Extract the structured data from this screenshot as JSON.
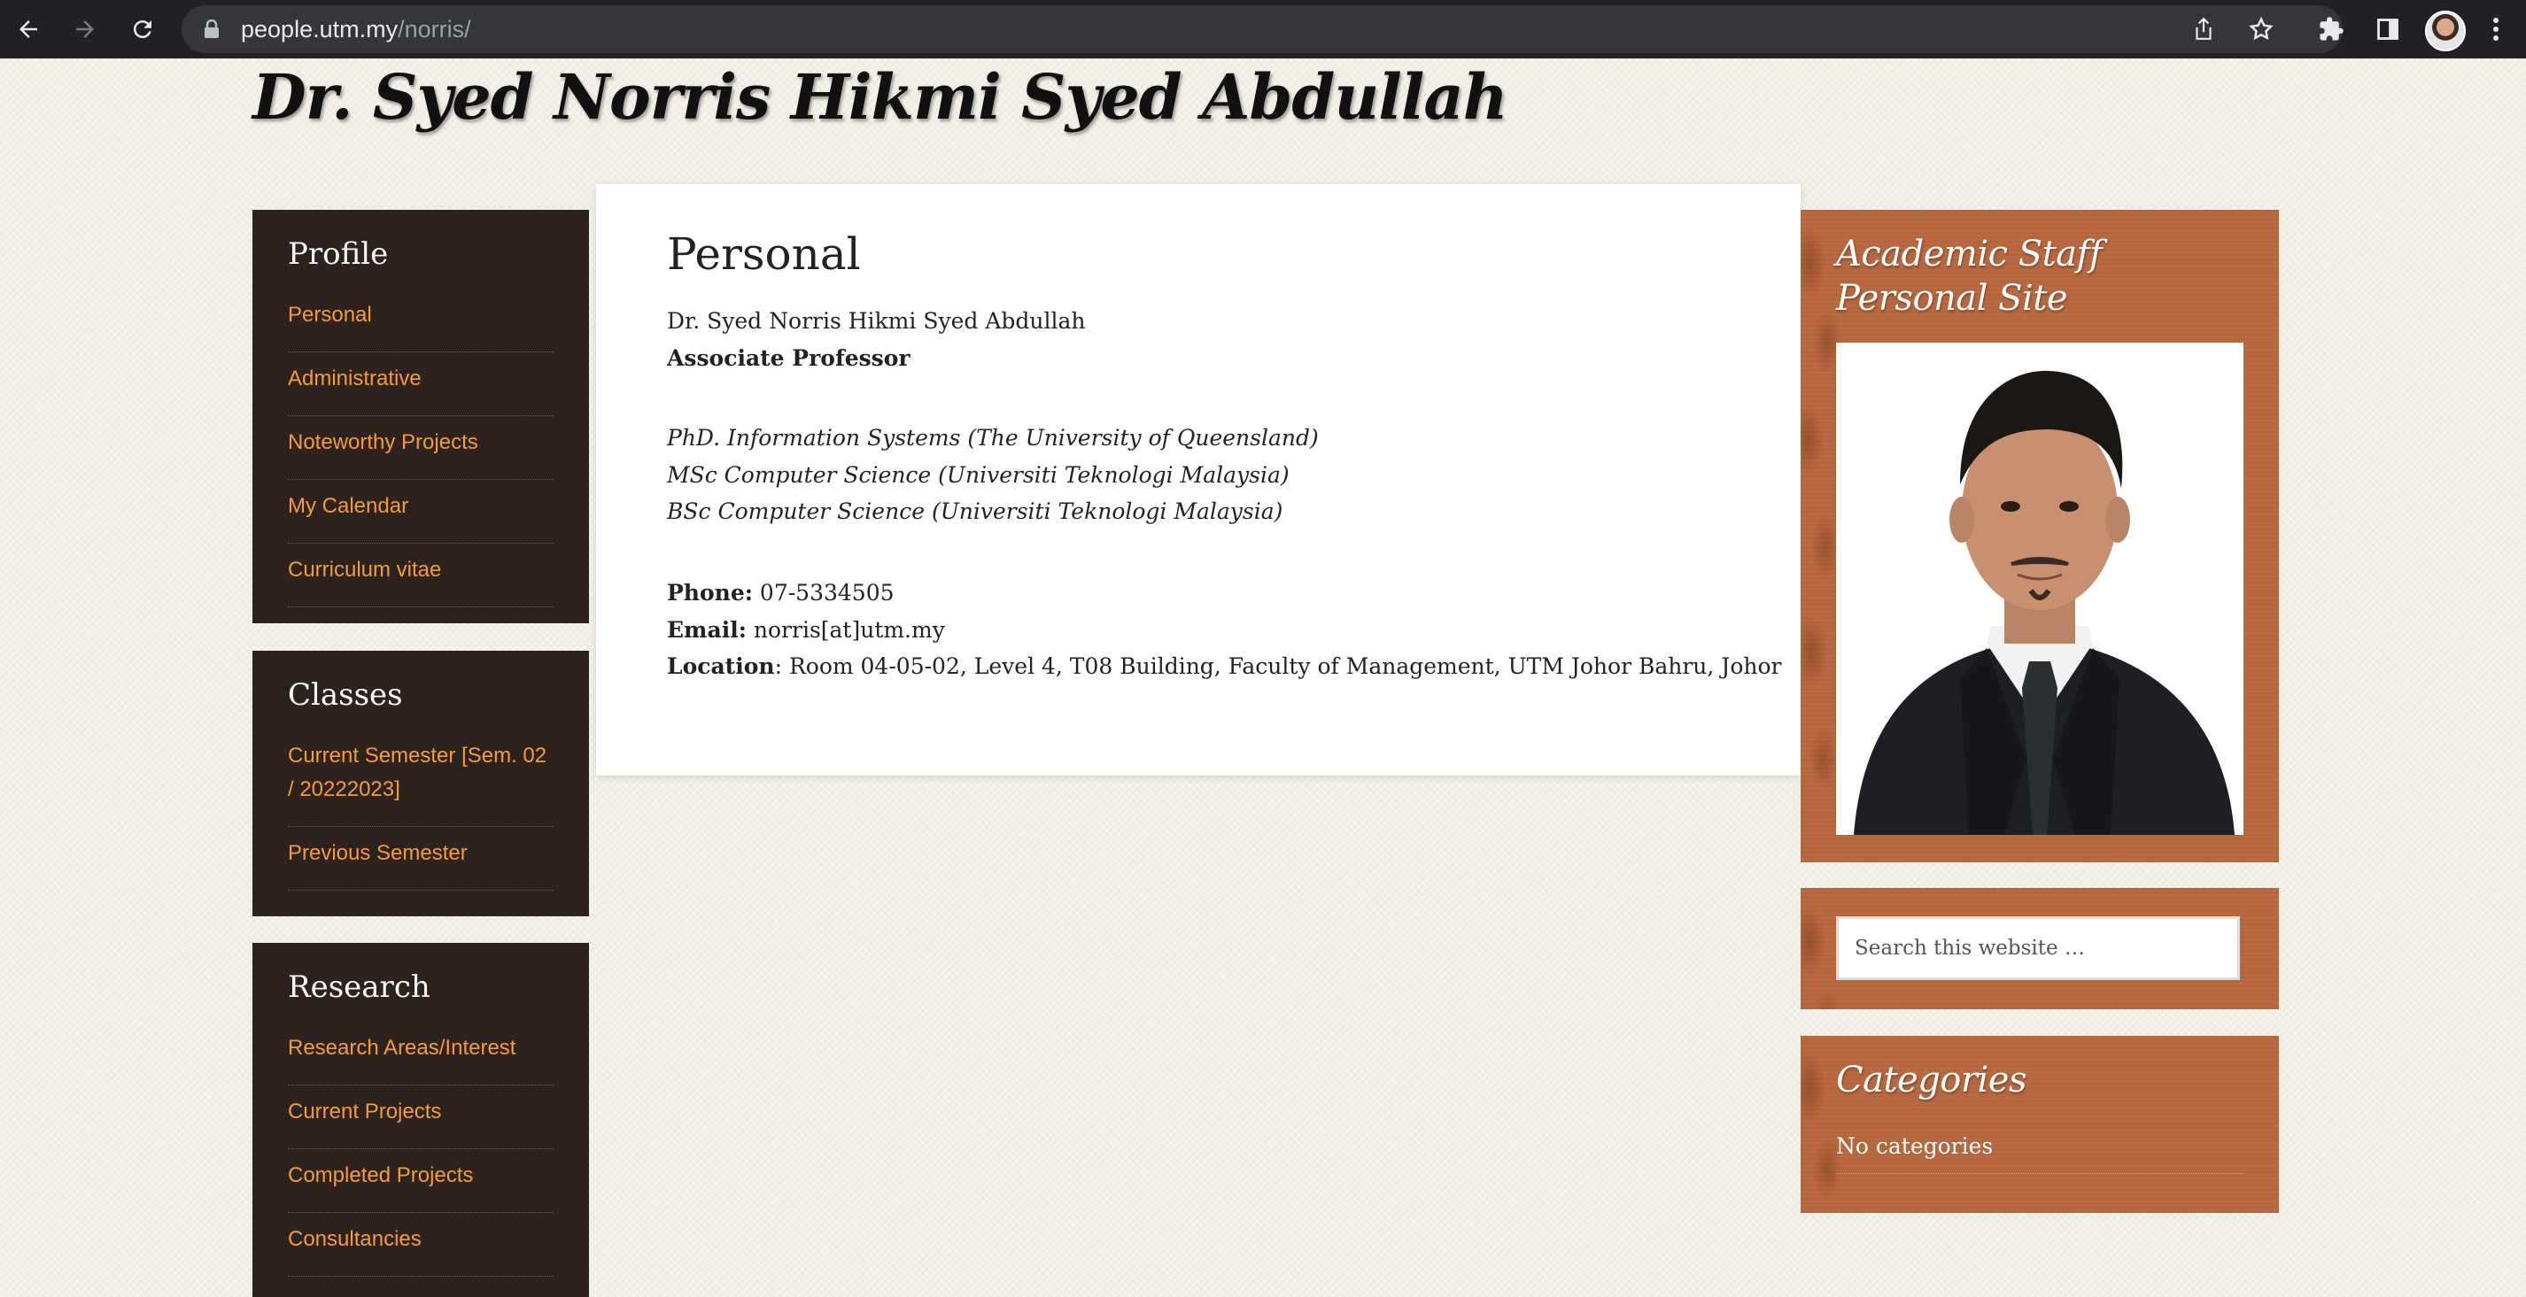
{
  "browser": {
    "url_domain": "people.utm.my",
    "url_path": "/norris/"
  },
  "site": {
    "title": "Dr. Syed Norris Hikmi Syed Abdullah"
  },
  "sidebar": {
    "profile": {
      "heading": "Profile",
      "items": [
        "Personal",
        "Administrative",
        "Noteworthy Projects",
        "My Calendar",
        "Curriculum vitae"
      ]
    },
    "classes": {
      "heading": "Classes",
      "items": [
        "Current Semester [Sem. 02 / 20222023]",
        "Previous Semester"
      ]
    },
    "research": {
      "heading": "Research",
      "items": [
        "Research Areas/Interest",
        "Current Projects",
        "Completed Projects",
        "Consultancies"
      ]
    }
  },
  "main": {
    "heading": "Personal",
    "name": "Dr. Syed Norris Hikmi Syed Abdullah",
    "position": "Associate Professor",
    "degrees": [
      "PhD. Information Systems (The University of Queensland)",
      "MSc Computer Science (Universiti Teknologi Malaysia)",
      "BSc Computer Science (Universiti Teknologi Malaysia)"
    ],
    "phone_label": "Phone:",
    "phone": "07-5334505",
    "email_label": "Email:",
    "email": "norris[at]utm.my",
    "location_label": "Location",
    "location": ": Room 04-05-02, Level 4, T08 Building, Faculty of Management, UTM Johor Bahru, Johor"
  },
  "right": {
    "staff_heading": "Academic Staff Personal Site",
    "search_placeholder": "Search this website …",
    "categories_heading": "Categories",
    "categories_text": "No categories"
  }
}
